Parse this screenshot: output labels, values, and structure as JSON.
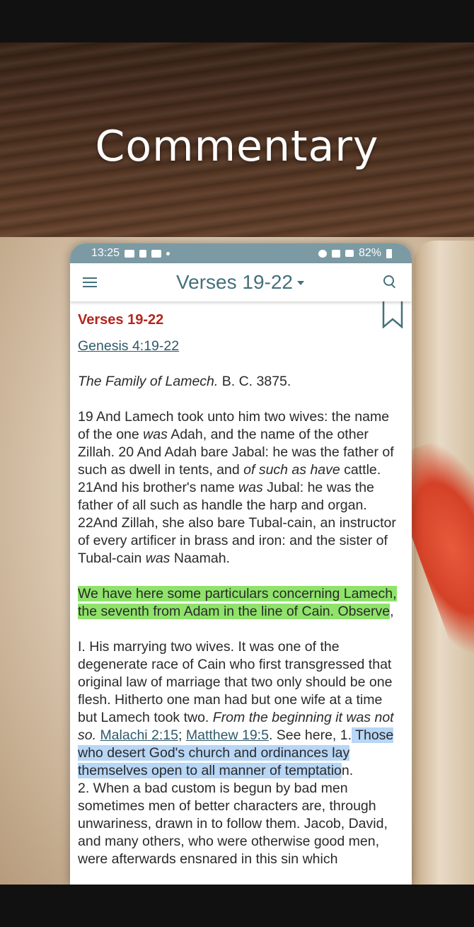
{
  "headline": "Commentary",
  "status_bar": {
    "time": "13:25",
    "battery": "82%"
  },
  "app_bar": {
    "title": "Verses 19-22"
  },
  "content": {
    "section_title": "Verses 19-22",
    "reference_link": "Genesis 4:19-22",
    "intro_italic": "The Family of Lamech.",
    "intro_date": "B. C. 3875.",
    "verse_paragraph": [
      "19 And Lamech took unto him two wives: the name of the one ",
      "was",
      " Adah, and the name of the other Zillah. 20 And Adah bare Jabal: he was the father of such as dwell in tents, and ",
      "of such as have",
      " cattle. 21And his brother's name ",
      "was",
      " Jubal: he was the father of all such as handle the harp and organ. 22And Zillah, she also bare Tubal-cain, an instructor of every artificer in brass and iron: and the sister of Tubal-cain ",
      "was",
      " Naamah."
    ],
    "highlighted_intro": "We have here some particulars concerning Lamech, the seventh from Adam in the line of Cain. Observe",
    "highlighted_intro_tail": ",",
    "commentary_part1": "I. His marrying two wives. It was one of the degenerate race of Cain who first transgressed that original law of marriage that two only should be one flesh. Hitherto one man had but one wife at a time but Lamech took two. ",
    "commentary_italic": "From the beginning it was not so.",
    "link_malachi": "Malachi 2:15",
    "separator": "; ",
    "link_matthew": "Matthew 19:5",
    "commentary_part2": ". See here, 1.",
    "highlighted_blue": " Those who desert God's church and ordinances lay themselves open to all manner of temptatio",
    "highlighted_blue_tail": "n.",
    "commentary_part3": "2. When a bad custom is begun by bad men sometimes men of better characters are, through unwariness, drawn in to follow them. Jacob, David, and many others, who were otherwise good men, were afterwards ensnared in this sin which"
  }
}
